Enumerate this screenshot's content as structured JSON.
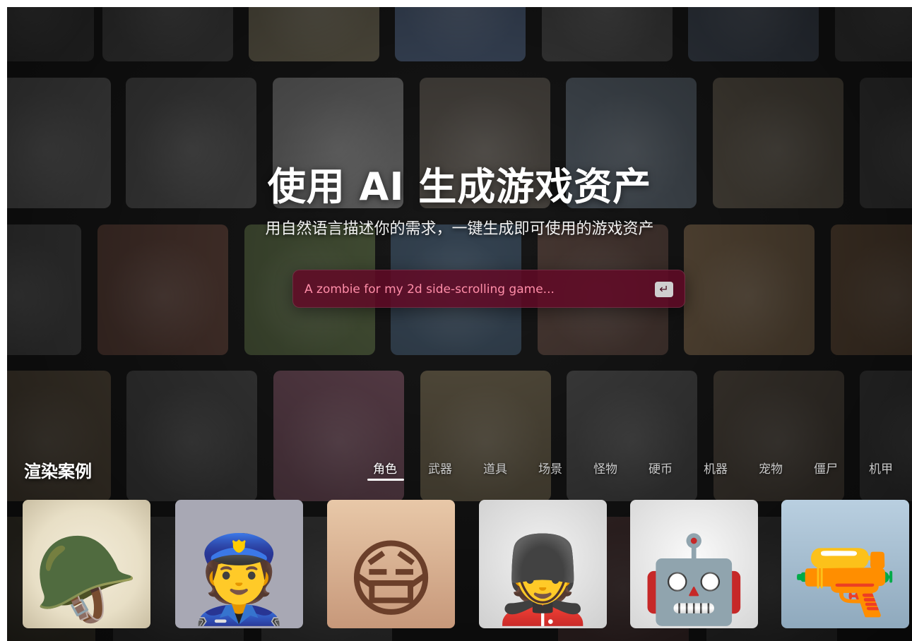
{
  "hero": {
    "title": "使用 AI 生成游戏资产",
    "subtitle": "用自然语言描述你的需求，一键生成即可使用的游戏资产"
  },
  "prompt": {
    "placeholder": "A zombie for my 2d side-scrolling game...",
    "submit_icon": "enter-icon",
    "submit_symbol": "↵"
  },
  "showcase": {
    "title": "渲染案例",
    "tabs": [
      "角色",
      "武器",
      "道具",
      "场景",
      "怪物",
      "硬币",
      "机器",
      "宠物",
      "僵尸",
      "机甲"
    ],
    "active_tab": "角色"
  },
  "colors": {
    "prompt_bg": "#600A26",
    "prompt_text": "#FF7F9D",
    "accent": "#FFFFFF"
  }
}
